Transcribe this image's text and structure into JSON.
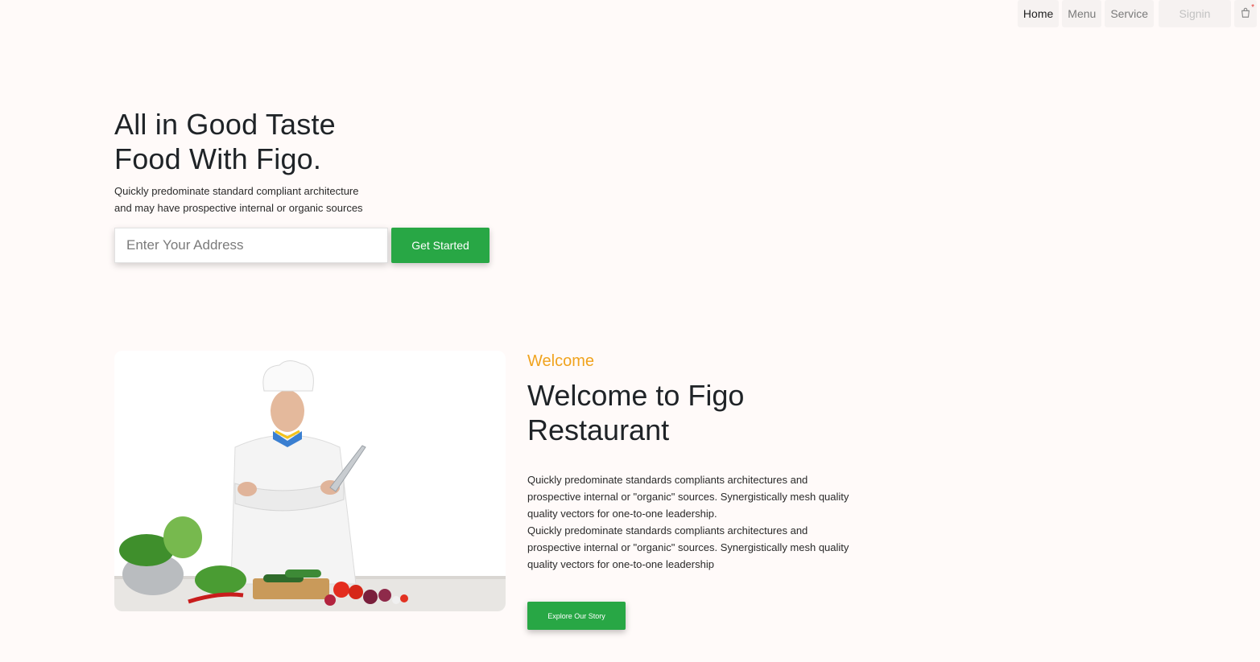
{
  "nav": {
    "items": [
      {
        "label": "Home",
        "active": true
      },
      {
        "label": "Menu",
        "active": false
      },
      {
        "label": "Service",
        "active": false
      }
    ],
    "signin_label": "Signin",
    "cart_icon": "cart-icon",
    "cart_badge": "*"
  },
  "hero": {
    "title_line1": "All in Good Taste",
    "title_line2": "Food With Figo.",
    "sub_line1": "Quickly predominate standard compliant architecture",
    "sub_line2": "and may have prospective internal or organic sources",
    "address_placeholder": "Enter Your Address",
    "cta_label": "Get Started"
  },
  "welcome": {
    "kicker": "Welcome",
    "title_line1": "Welcome to Figo",
    "title_line2": "Restaurant",
    "para1": "Quickly predominate standards compliants architectures and prospective internal or \"organic\" sources. Synergistically mesh quality quality vectors for one-to-one leadership.",
    "para2": "Quickly predominate standards compliants architectures and prospective internal or \"organic\" sources. Synergistically mesh quality quality vectors for one-to-one leadership",
    "cta_label": "Explore Our Story",
    "image_icon": "chef-image"
  },
  "colors": {
    "background": "#fffaf9",
    "accent_green": "#28a745",
    "kicker_orange": "#f0a31e",
    "cart_badge_red": "#e53935"
  }
}
